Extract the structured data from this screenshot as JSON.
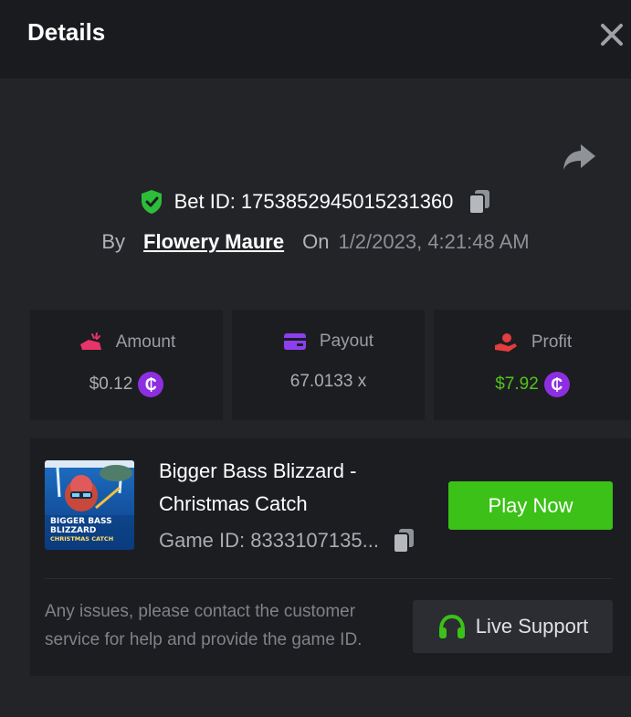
{
  "header": {
    "title": "Details"
  },
  "bet": {
    "id_label": "Bet ID: 1753852945015231360",
    "by_label": "By",
    "username": "Flowery Maure",
    "on_label": "On",
    "datetime": "1/2/2023, 4:21:48 AM"
  },
  "stats": {
    "amount_label": "Amount",
    "amount_value": "$0.12",
    "payout_label": "Payout",
    "payout_value": "67.0133 x",
    "profit_label": "Profit",
    "profit_value": "$7.92",
    "coin_symbol": "₵"
  },
  "game": {
    "name_line1": "Bigger Bass Blizzard -",
    "name_line2": "Christmas Catch",
    "id_label": "Game ID: 8333107135...",
    "play_button": "Play Now",
    "thumbnail_text_1": "BIGGER BASS",
    "thumbnail_text_2": "BLIZZARD",
    "thumbnail_text_3": "CHRISTMAS CATCH"
  },
  "support": {
    "note": "Any issues, please contact the customer service for help and provide the game ID.",
    "button": "Live Support"
  },
  "colors": {
    "accent_green": "#3bc117",
    "profit_green": "#52c41a",
    "coin_purple": "#8d2fe0",
    "amount_icon": "#e8336b",
    "payout_icon": "#8d3ff0",
    "profit_icon": "#e33d3d"
  },
  "icons": [
    "close-icon",
    "share-icon",
    "shield-check-icon",
    "copy-icon",
    "amount-icon",
    "payout-card-icon",
    "profit-hand-icon",
    "coin-icon",
    "headset-icon"
  ]
}
